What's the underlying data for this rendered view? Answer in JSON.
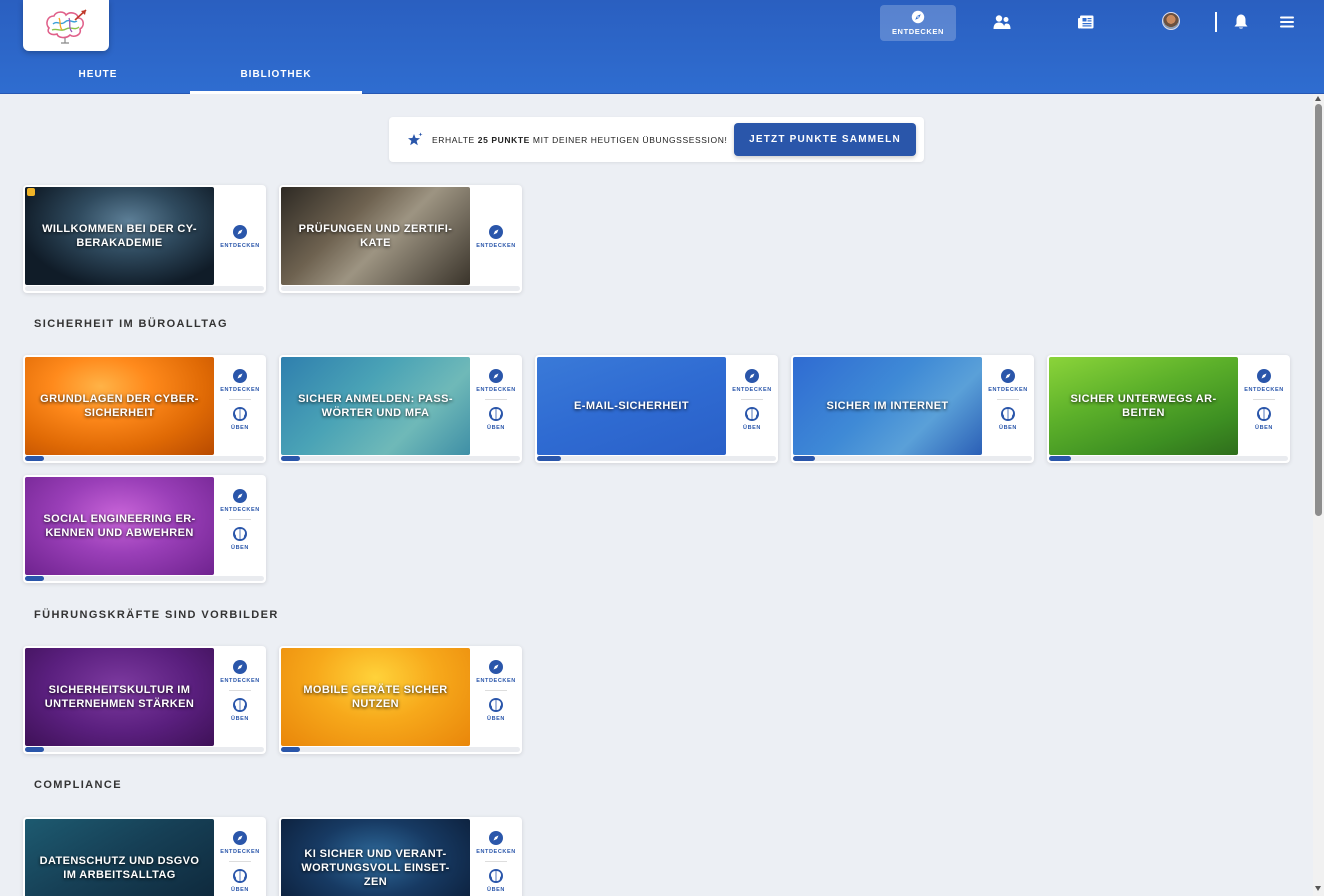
{
  "header": {
    "tabs": [
      {
        "label": "HEUTE",
        "active": false
      },
      {
        "label": "BIBLIOTHEK",
        "active": true
      }
    ],
    "nav": {
      "entdecken_label": "ENTDECKEN",
      "icons": [
        "compass-icon",
        "users-icon",
        "news-icon",
        "avatar",
        "bell-icon",
        "menu-icon"
      ]
    }
  },
  "promo": {
    "text_before": "Erhalte ",
    "points": "25 Punkte",
    "text_after": " mit deiner heutigen Übungssession!",
    "button": "JETZT PUNKTE SAMMELN"
  },
  "labels": {
    "explore": "ENTDECKEN",
    "practice": "ÜBEN"
  },
  "intro_cards": [
    {
      "title": "WILLKOMMEN BEI DER CY-BERAKADEMIE",
      "progress": 0
    },
    {
      "title": "PRÜFUNGEN UND ZERTIFI-KATE",
      "progress": 0
    }
  ],
  "sections": [
    {
      "title": "SICHERHEIT IM BÜROALLTAG",
      "cards": [
        {
          "title": "GRUNDLAGEN DER CYBER-SICHERHEIT",
          "progress": 0.08
        },
        {
          "title": "SICHER ANMELDEN: PASS-WÖRTER UND MFA",
          "progress": 0.08
        },
        {
          "title": "E-MAIL-SICHERHEIT",
          "progress": 0.1
        },
        {
          "title": "SICHER IM INTERNET",
          "progress": 0.09
        },
        {
          "title": "SICHER UNTERWEGS AR-BEITEN",
          "progress": 0.09
        },
        {
          "title": "SOCIAL ENGINEERING ER-KENNEN UND ABWEHREN",
          "progress": 0.08
        }
      ]
    },
    {
      "title": "FÜHRUNGSKRÄFTE SIND VORBILDER",
      "cards": [
        {
          "title": "SICHERHEITSKULTUR IM UNTERNEHMEN STÄRKEN",
          "progress": 0.08
        },
        {
          "title": "MOBILE GERÄTE SICHER NUTZEN",
          "progress": 0.08
        }
      ]
    },
    {
      "title": "COMPLIANCE",
      "cards": [
        {
          "title": "DATENSCHUTZ UND DSGVO IM ARBEITSALLTAG",
          "progress": 0
        },
        {
          "title": "KI SICHER UND VERANT-WORTUNGSVOLL EINSET-ZEN",
          "progress": 0
        }
      ]
    }
  ],
  "colors": {
    "brand": "#2a56aa",
    "header": "#2f6dd0",
    "background": "#eceff4"
  }
}
